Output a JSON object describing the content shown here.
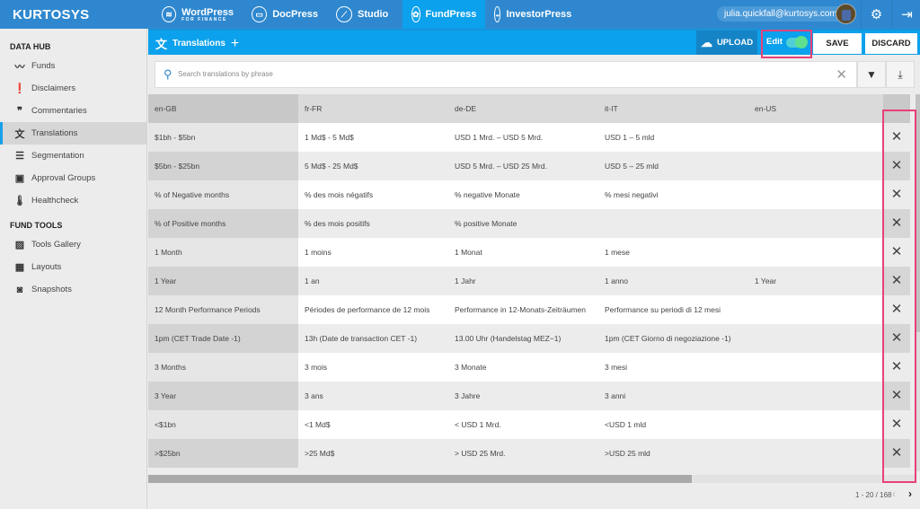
{
  "brand": "KURTOSYS",
  "apps": [
    {
      "label": "WordPress",
      "sub": "FOR FINANCE",
      "icon": "wordpress-stack-icon",
      "glyph": "≋"
    },
    {
      "label": "DocPress",
      "icon": "docpress-icon",
      "glyph": "▭"
    },
    {
      "label": "Studio",
      "icon": "brush-icon",
      "glyph": "⟋"
    },
    {
      "label": "FundPress",
      "icon": "fundpress-icon",
      "glyph": "✿",
      "active": true
    },
    {
      "label": "InvestorPress",
      "icon": "investorpress-icon",
      "glyph": "◒"
    }
  ],
  "user": {
    "email": "julia.quickfall@kurtosys.com"
  },
  "icons": {
    "settings": "⚙",
    "logout": "⇥"
  },
  "sidebar": {
    "sections": [
      {
        "title": "DATA HUB",
        "items": [
          {
            "label": "Funds",
            "icon": "chart-line-icon",
            "glyph": "〰"
          },
          {
            "label": "Disclaimers",
            "icon": "comment-alert-icon",
            "glyph": "❗"
          },
          {
            "label": "Commentaries",
            "icon": "quote-icon",
            "glyph": "❞"
          },
          {
            "label": "Translations",
            "icon": "translate-icon",
            "glyph": "文",
            "active": true
          },
          {
            "label": "Segmentation",
            "icon": "list-add-icon",
            "glyph": "☰"
          },
          {
            "label": "Approval Groups",
            "icon": "folder-user-icon",
            "glyph": "▣"
          },
          {
            "label": "Healthcheck",
            "icon": "thermometer-icon",
            "glyph": "🌡"
          }
        ]
      },
      {
        "title": "FUND TOOLS",
        "items": [
          {
            "label": "Tools Gallery",
            "icon": "image-icon",
            "glyph": "▨"
          },
          {
            "label": "Layouts",
            "icon": "layout-icon",
            "glyph": "▦"
          },
          {
            "label": "Snapshots",
            "icon": "camera-icon",
            "glyph": "◙"
          }
        ]
      }
    ]
  },
  "subheader": {
    "title": "Translations",
    "upload_label": "UPLOAD",
    "edit_label": "Edit",
    "edit_enabled": true,
    "save_label": "SAVE",
    "discard_label": "DISCARD"
  },
  "search": {
    "placeholder": "Search translations by phrase",
    "value": ""
  },
  "table": {
    "columns": [
      "en-GB",
      "fr-FR",
      "de-DE",
      "it-IT",
      "en-US"
    ],
    "rows": [
      [
        "$1bh - $5bn",
        "1 Md$ - 5 Md$",
        "USD 1 Mrd. – USD 5 Mrd.",
        "USD 1 – 5 mld",
        ""
      ],
      [
        "$5bn - $25bn",
        "5 Md$ - 25 Md$",
        "USD 5 Mrd. – USD 25 Mrd.",
        "USD 5 – 25 mld",
        ""
      ],
      [
        "% of Negative months",
        "% des mois négatifs",
        "% negative Monate",
        "% mesi negativi",
        ""
      ],
      [
        "% of Positive months",
        "% des mois positifs",
        "% positive Monate",
        "",
        ""
      ],
      [
        "1 Month",
        "1 moins",
        "1 Monat",
        "1 mese",
        ""
      ],
      [
        "1 Year",
        "1 an",
        "1 Jahr",
        "1 anno",
        "1 Year"
      ],
      [
        "12 Month Performance Periods",
        "Périodes de performance de 12 mois",
        "Performance in 12-Monats-Zeiträumen",
        "Performance su periodi di 12 mesi",
        ""
      ],
      [
        "1pm (CET Trade Date -1)",
        "13h (Date de transaction CET -1)",
        "13.00 Uhr (Handelstag MEZ−1)",
        "1pm (CET Giorno di negoziazione -1)",
        ""
      ],
      [
        "3 Months",
        "3 mois",
        "3 Monate",
        "3 mesi",
        ""
      ],
      [
        "3 Year",
        "3 ans",
        "3 Jahre",
        "3 anni",
        ""
      ],
      [
        "<$1bn",
        "<1 Md$",
        "< USD 1 Mrd.",
        "<USD 1 mld",
        ""
      ],
      [
        ">$25bn",
        ">25 Md$",
        "> USD 25 Mrd.",
        ">USD 25 mld",
        ""
      ]
    ],
    "delete_glyph": "✕"
  },
  "pagination": {
    "label": "1 - 20 / 168",
    "prev": "‹",
    "next": "›"
  },
  "colors": {
    "topbar": "#2f88cf",
    "accent": "#0ba1ec",
    "highlight": "#e8407a",
    "toggle_on": "#5ee08e"
  }
}
